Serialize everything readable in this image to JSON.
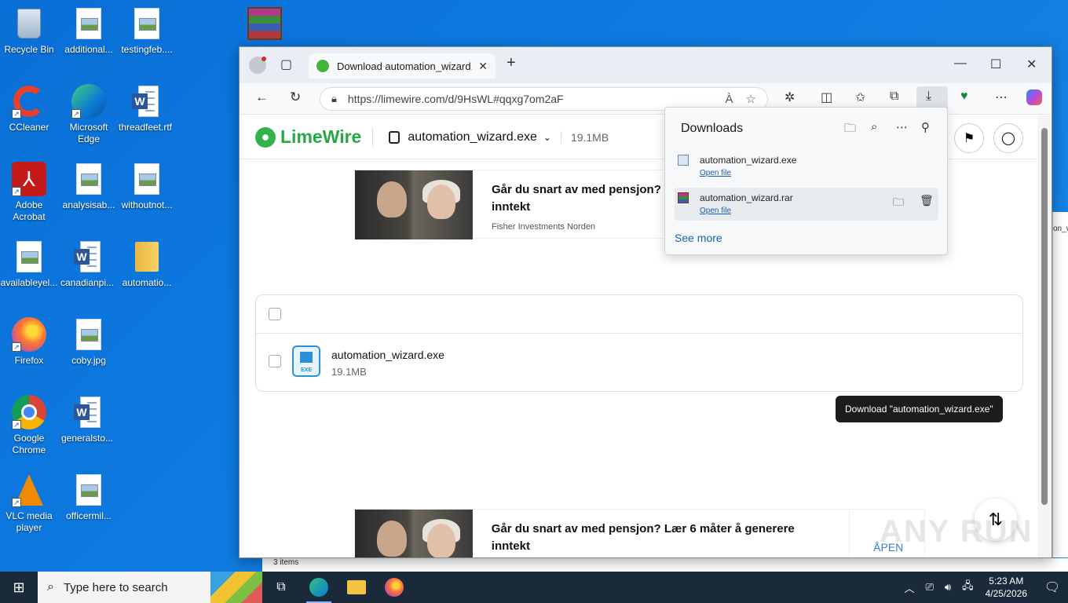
{
  "desktop": {
    "icons": [
      {
        "label": "Recycle Bin",
        "kind": "recycle"
      },
      {
        "label": "additional...",
        "kind": "doc"
      },
      {
        "label": "testingfeb....",
        "kind": "doc"
      },
      {
        "label": "CCleaner",
        "kind": "ccleaner"
      },
      {
        "label": "Microsoft Edge",
        "kind": "edge"
      },
      {
        "label": "threadfeet.rtf",
        "kind": "word"
      },
      {
        "label": "Adobe Acrobat",
        "kind": "acrobat"
      },
      {
        "label": "analysisab...",
        "kind": "doc"
      },
      {
        "label": "withoutnot...",
        "kind": "doc"
      },
      {
        "label": "availableyel...",
        "kind": "doc"
      },
      {
        "label": "canadianpi...",
        "kind": "word"
      },
      {
        "label": "automatio...",
        "kind": "folder"
      },
      {
        "label": "Firefox",
        "kind": "firefox"
      },
      {
        "label": "coby.jpg",
        "kind": "doc"
      },
      {
        "label": "Google Chrome",
        "kind": "chrome"
      },
      {
        "label": "generalsto...",
        "kind": "word"
      },
      {
        "label": "VLC media player",
        "kind": "vlc"
      },
      {
        "label": "officermil...",
        "kind": "doc"
      }
    ]
  },
  "browser": {
    "tab": {
      "title": "Download automation_wizard.exe",
      "close": "✕"
    },
    "new_tab": "+",
    "window_controls": {
      "minimize": "—",
      "maximize": "☐",
      "close": "✕"
    },
    "url": "https://limewire.com/d/9HsWL#qqxg7om2aF",
    "url_read_aloud": "À",
    "url_favorite": "☆"
  },
  "page": {
    "brand": "LimeWire",
    "file_title": "automation_wizard.exe",
    "file_size_header": "19.1MB",
    "ad": {
      "headline_top": "Går du snart av med pensjon?",
      "headline_top_line2": "inntekt",
      "advertiser": "Fisher Investments Norden",
      "headline_bottom": "Går du snart av med pensjon? Lær 6 måter å generere inntekt",
      "open_label": "ÅPEN"
    },
    "file": {
      "name": "automation_wizard.exe",
      "size": "19.1MB",
      "icon_label": "EXE"
    },
    "tooltip": "Download \"automation_wizard.exe\""
  },
  "downloads_panel": {
    "title": "Downloads",
    "items": [
      {
        "name": "automation_wizard.exe",
        "action": "Open file"
      },
      {
        "name": "automation_wizard.rar",
        "action": "Open file"
      }
    ],
    "see_more": "See more"
  },
  "behind_window": {
    "status": "3 items",
    "edge_text": "on_v"
  },
  "watermark": "ANY RUN",
  "taskbar": {
    "search_placeholder": "Type here to search",
    "time": "5:23 AM",
    "date": "4/25/2026"
  }
}
